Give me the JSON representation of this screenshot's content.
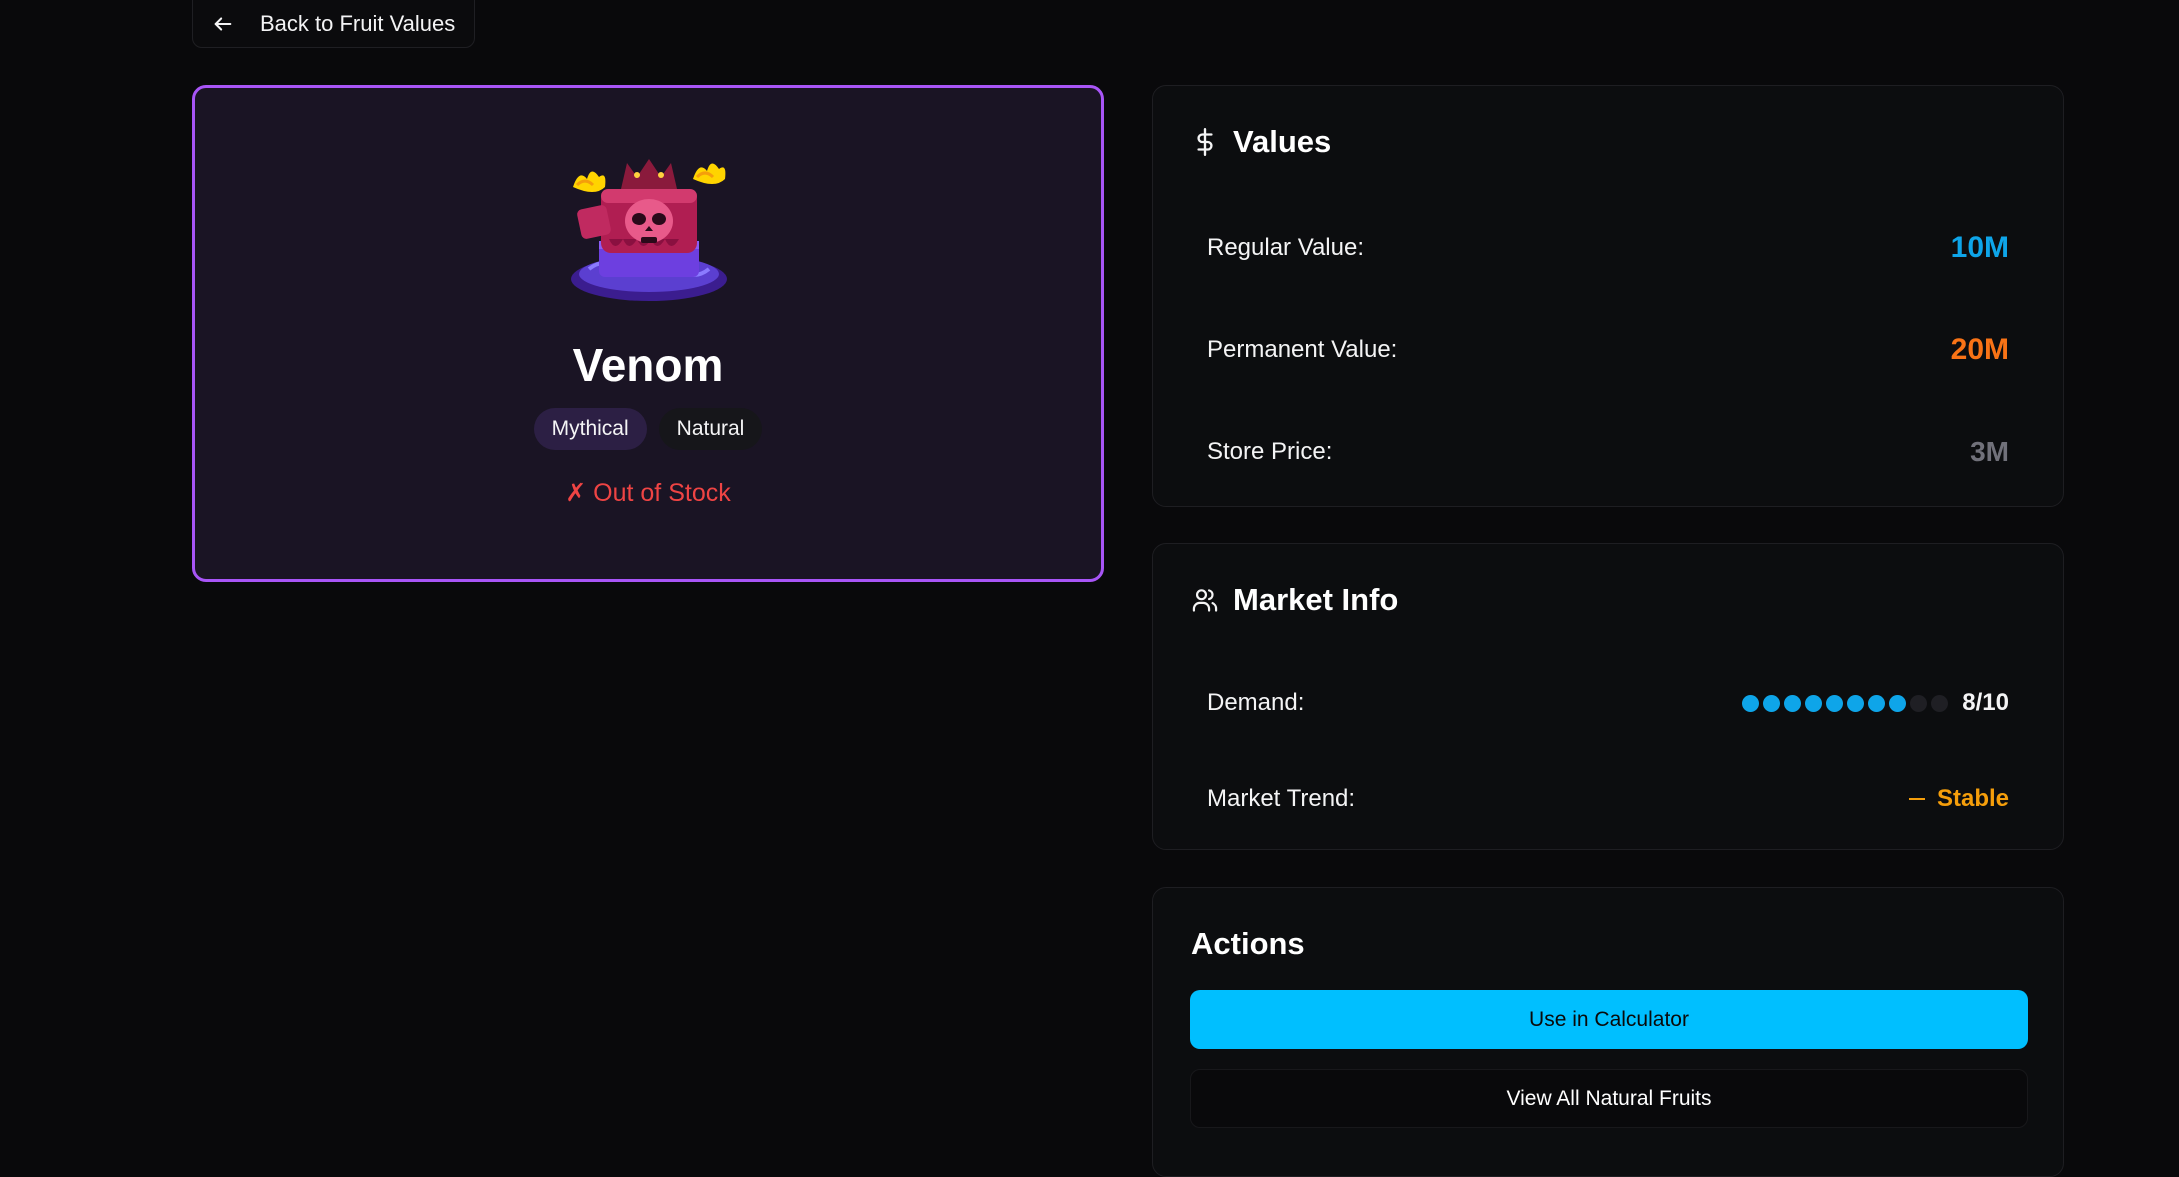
{
  "nav": {
    "back_label": "Back to Fruit Values",
    "back_icon": "arrow-left-icon"
  },
  "fruit": {
    "name": "Venom",
    "image_alt": "Venom fruit",
    "rarity": "Mythical",
    "type": "Natural",
    "stock_status": "✗ Out of Stock",
    "colors": {
      "border": "#a855f7",
      "card_bg": "#1a1424",
      "stock": "#ef4444"
    }
  },
  "values": {
    "title": "Values",
    "icon": "dollar-icon",
    "regular_label": "Regular Value:",
    "regular_value": "10M",
    "permanent_label": "Permanent Value:",
    "permanent_value": "20M",
    "store_label": "Store Price:",
    "store_value": "3M",
    "colors": {
      "regular": "#0ea5e9",
      "permanent": "#f97316",
      "store": "#71717a"
    }
  },
  "market": {
    "title": "Market Info",
    "icon": "users-icon",
    "demand_label": "Demand:",
    "demand_value": 8,
    "demand_max": 10,
    "demand_text": "8/10",
    "trend_label": "Market Trend:",
    "trend_value": "Stable",
    "trend_icon": "minus-icon",
    "colors": {
      "demand": "#0ea5e9",
      "trend": "#f59e0b"
    }
  },
  "actions": {
    "title": "Actions",
    "calculator_label": "Use in Calculator",
    "view_all_label": "View All Natural Fruits",
    "colors": {
      "primary": "#00bfff"
    }
  }
}
